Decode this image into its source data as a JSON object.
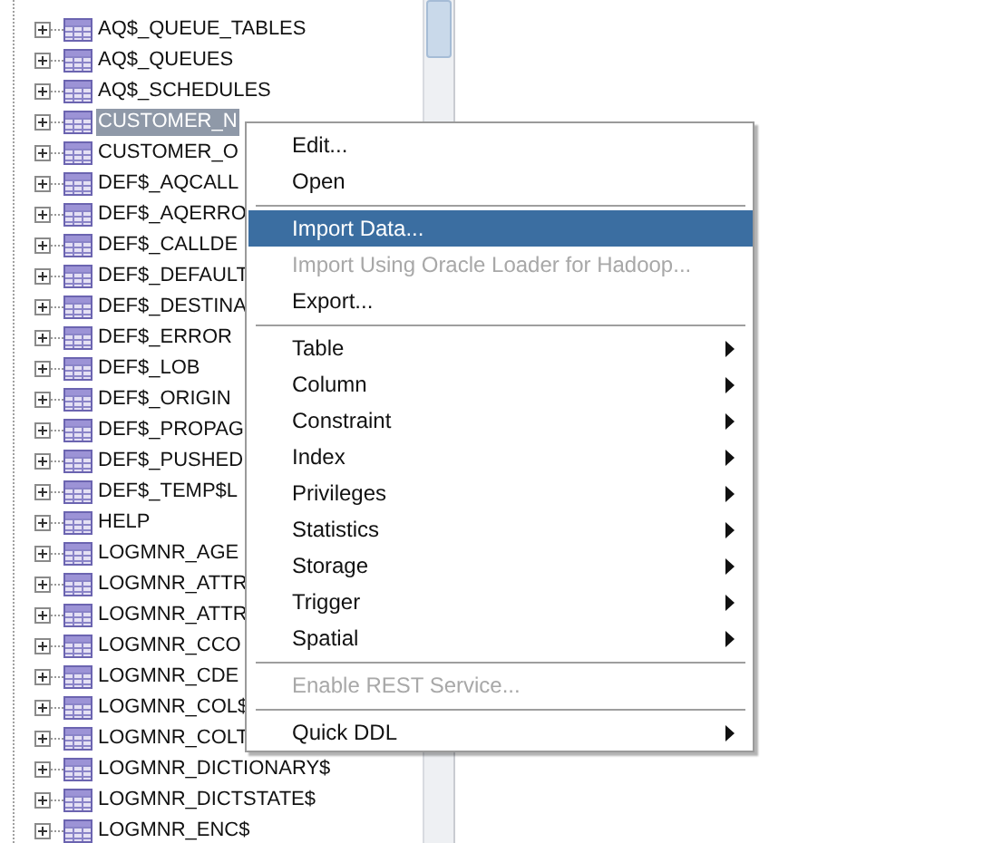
{
  "tree": {
    "items": [
      {
        "label": "AQ$_QUEUE_TABLES",
        "selected": false
      },
      {
        "label": "AQ$_QUEUES",
        "selected": false
      },
      {
        "label": "AQ$_SCHEDULES",
        "selected": false
      },
      {
        "label": "CUSTOMER_N",
        "selected": true
      },
      {
        "label": "CUSTOMER_O",
        "selected": false
      },
      {
        "label": "DEF$_AQCALL",
        "selected": false
      },
      {
        "label": "DEF$_AQERRO",
        "selected": false
      },
      {
        "label": "DEF$_CALLDE",
        "selected": false
      },
      {
        "label": "DEF$_DEFAULT",
        "selected": false
      },
      {
        "label": "DEF$_DESTINA",
        "selected": false
      },
      {
        "label": "DEF$_ERROR",
        "selected": false
      },
      {
        "label": "DEF$_LOB",
        "selected": false
      },
      {
        "label": "DEF$_ORIGIN",
        "selected": false
      },
      {
        "label": "DEF$_PROPAG",
        "selected": false
      },
      {
        "label": "DEF$_PUSHED",
        "selected": false
      },
      {
        "label": "DEF$_TEMP$L",
        "selected": false
      },
      {
        "label": "HELP",
        "selected": false
      },
      {
        "label": "LOGMNR_AGE",
        "selected": false
      },
      {
        "label": "LOGMNR_ATTR",
        "selected": false
      },
      {
        "label": "LOGMNR_ATTR",
        "selected": false
      },
      {
        "label": "LOGMNR_CCO",
        "selected": false
      },
      {
        "label": "LOGMNR_CDE",
        "selected": false
      },
      {
        "label": "LOGMNR_COL$",
        "selected": false
      },
      {
        "label": "LOGMNR_COLT",
        "selected": false
      },
      {
        "label": "LOGMNR_DICTIONARY$",
        "selected": false
      },
      {
        "label": "LOGMNR_DICTSTATE$",
        "selected": false
      },
      {
        "label": "LOGMNR_ENC$",
        "selected": false
      }
    ]
  },
  "context_menu": {
    "items": [
      {
        "kind": "item",
        "label": "Edit...",
        "selected": false,
        "disabled": false,
        "submenu": false
      },
      {
        "kind": "item",
        "label": "Open",
        "selected": false,
        "disabled": false,
        "submenu": false
      },
      {
        "kind": "separator"
      },
      {
        "kind": "item",
        "label": "Import Data...",
        "selected": true,
        "disabled": false,
        "submenu": false
      },
      {
        "kind": "item",
        "label": "Import Using Oracle Loader for Hadoop...",
        "selected": false,
        "disabled": true,
        "submenu": false
      },
      {
        "kind": "item",
        "label": "Export...",
        "selected": false,
        "disabled": false,
        "submenu": false
      },
      {
        "kind": "separator"
      },
      {
        "kind": "item",
        "label": "Table",
        "selected": false,
        "disabled": false,
        "submenu": true
      },
      {
        "kind": "item",
        "label": "Column",
        "selected": false,
        "disabled": false,
        "submenu": true
      },
      {
        "kind": "item",
        "label": "Constraint",
        "selected": false,
        "disabled": false,
        "submenu": true
      },
      {
        "kind": "item",
        "label": "Index",
        "selected": false,
        "disabled": false,
        "submenu": true
      },
      {
        "kind": "item",
        "label": "Privileges",
        "selected": false,
        "disabled": false,
        "submenu": true
      },
      {
        "kind": "item",
        "label": "Statistics",
        "selected": false,
        "disabled": false,
        "submenu": true
      },
      {
        "kind": "item",
        "label": "Storage",
        "selected": false,
        "disabled": false,
        "submenu": true
      },
      {
        "kind": "item",
        "label": "Trigger",
        "selected": false,
        "disabled": false,
        "submenu": true
      },
      {
        "kind": "item",
        "label": "Spatial",
        "selected": false,
        "disabled": false,
        "submenu": true
      },
      {
        "kind": "separator"
      },
      {
        "kind": "item",
        "label": "Enable REST Service...",
        "selected": false,
        "disabled": true,
        "submenu": false
      },
      {
        "kind": "separator"
      },
      {
        "kind": "item",
        "label": "Quick DDL",
        "selected": false,
        "disabled": false,
        "submenu": true
      }
    ]
  }
}
